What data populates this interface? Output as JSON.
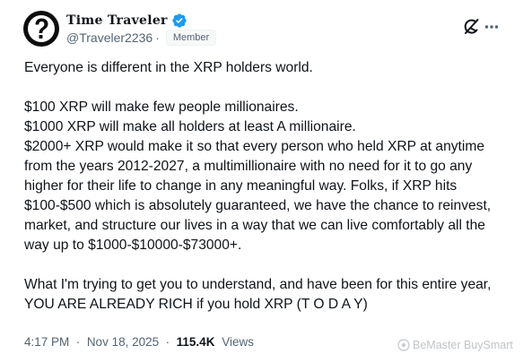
{
  "author": {
    "display_name": "Time Traveler",
    "handle": "@Traveler2236",
    "separator": "·",
    "badge": "Member",
    "avatar_icon": "question-mark-avatar",
    "verified_icon": "verified-badge-icon",
    "verified_color": "#1d9bf0"
  },
  "actions": {
    "grok_icon": "grok-icon",
    "more_icon": "more-horizontal-icon"
  },
  "tweet": {
    "line1": "Everyone is different in the XRP holders world.",
    "line2": "$100 XRP will make few people millionaires.",
    "line3": "$1000 XRP will make all holders at least A millionaire.",
    "line4": "$2000+ XRP would make it so that every person who held XRP at anytime from the years 2012-2027, a multimillionaire with no need for it to go any higher for their life to change in any meaningful way. Folks, if XRP hits $100-$500 which is absolutely guaranteed, we have the chance to reinvest, market, and structure our lives in a way that we can live comfortably all the way up to $1000-$10000-$73000+.",
    "line5": "What I'm trying to get you to understand, and have been for this entire year, YOU ARE ALREADY RICH if you hold XRP (T O D A Y)"
  },
  "meta": {
    "time": "4:17 PM",
    "dot1": "·",
    "date": "Nov 18, 2025",
    "dot2": "·",
    "views_count": "115.4K",
    "views_label": "Views"
  },
  "watermark": {
    "text": "BeMaster BuySmart"
  },
  "colors": {
    "text": "#0f1419",
    "secondary": "#536471",
    "background": "#ffffff"
  }
}
